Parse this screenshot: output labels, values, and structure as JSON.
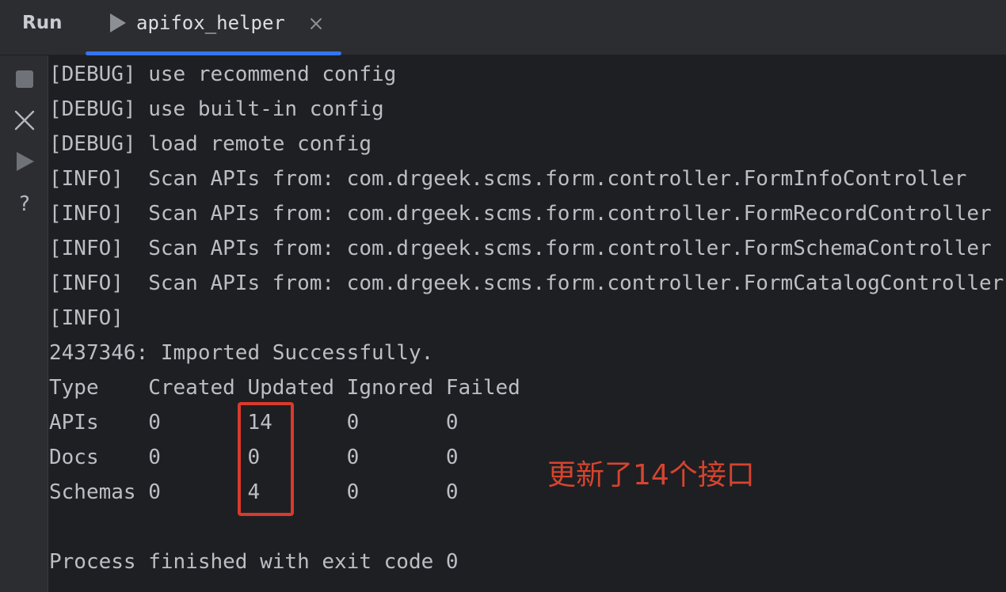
{
  "header": {
    "run_label": "Run",
    "tab": {
      "label": "apifox_helper",
      "accent": "#3574f0",
      "icon": "play-icon"
    }
  },
  "toolbar": {
    "icons": [
      "stop-icon",
      "close-icon",
      "rerun-icon",
      "help-icon"
    ]
  },
  "console": {
    "lines": [
      "[DEBUG] use recommend config",
      "[DEBUG] use built-in config",
      "[DEBUG] load remote config",
      "[INFO]  Scan APIs from: com.drgeek.scms.form.controller.FormInfoController",
      "[INFO]  Scan APIs from: com.drgeek.scms.form.controller.FormRecordController",
      "[INFO]  Scan APIs from: com.drgeek.scms.form.controller.FormSchemaController",
      "[INFO]  Scan APIs from: com.drgeek.scms.form.controller.FormCatalogController",
      "[INFO]",
      "2437346: Imported Successfully.",
      "Type    Created Updated Ignored Failed",
      "APIs    0       14      0       0",
      "Docs    0       0       0       0",
      "Schemas 0       4       0       0",
      "",
      "Process finished with exit code 0"
    ]
  },
  "annotation": {
    "text": "更新了14个接口",
    "color": "#d6442f"
  }
}
